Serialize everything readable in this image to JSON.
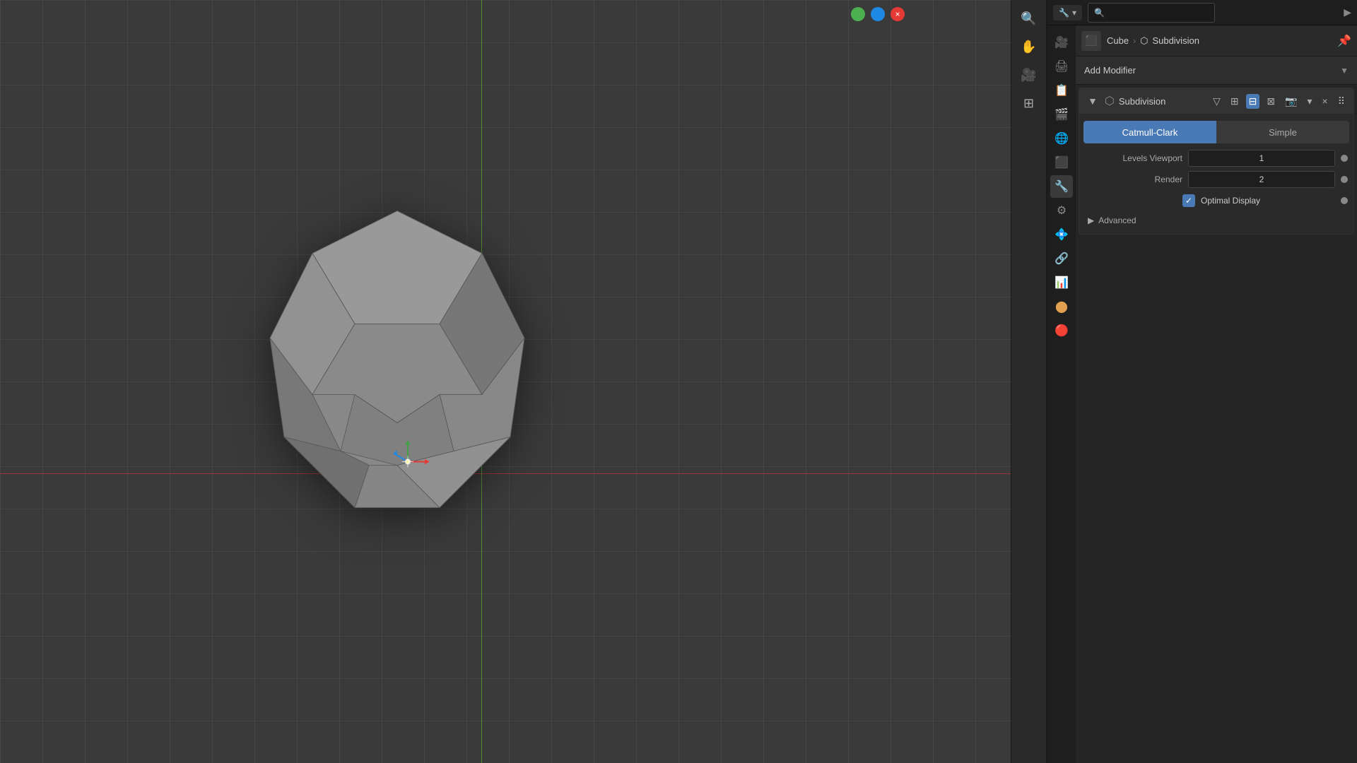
{
  "viewport": {
    "background_color": "#3a3a3a"
  },
  "window_controls": {
    "close_label": "×"
  },
  "toolbar_buttons": [
    {
      "name": "zoom",
      "icon": "🔍"
    },
    {
      "name": "pan",
      "icon": "✋"
    },
    {
      "name": "camera",
      "icon": "🎥"
    },
    {
      "name": "grid",
      "icon": "⊞"
    }
  ],
  "header": {
    "search_placeholder": "🔍",
    "breadcrumb_object": "Cube",
    "breadcrumb_sep": "›",
    "breadcrumb_modifier_icon": "⬡",
    "breadcrumb_modifier": "Subdivision",
    "pin_icon": "📌"
  },
  "add_modifier": {
    "label": "Add Modifier",
    "arrow": "▼"
  },
  "modifier": {
    "name": "Subdivision",
    "collapse_icon": "▼",
    "object_icon": "⬡",
    "icons": [
      "▽",
      "⊞",
      "⊟",
      "⊠",
      "📷"
    ],
    "expand_icon": "▾",
    "delete_icon": "×",
    "grid_icon": "⠿"
  },
  "type_selector": {
    "catmull_clark": "Catmull-Clark",
    "simple": "Simple"
  },
  "params": {
    "levels_viewport_label": "Levels Viewport",
    "levels_viewport_value": "1",
    "render_label": "Render",
    "render_value": "2",
    "optimal_display_label": "Optimal Display",
    "optimal_display_checked": true,
    "advanced_label": "Advanced"
  },
  "sidebar": {
    "icons": [
      {
        "name": "render",
        "icon": "🎥",
        "active": false
      },
      {
        "name": "output",
        "icon": "🖨",
        "active": false
      },
      {
        "name": "view-layer",
        "icon": "📋",
        "active": false
      },
      {
        "name": "scene",
        "icon": "🎬",
        "active": false
      },
      {
        "name": "world",
        "icon": "🌐",
        "active": false
      },
      {
        "name": "object",
        "icon": "⬛",
        "active": false
      },
      {
        "name": "modifiers",
        "icon": "🔧",
        "active": true
      },
      {
        "name": "particles",
        "icon": "⚙",
        "active": false
      },
      {
        "name": "physics",
        "icon": "💠",
        "active": false
      },
      {
        "name": "constraints",
        "icon": "🔗",
        "active": false
      },
      {
        "name": "data",
        "icon": "📊",
        "active": false
      },
      {
        "name": "material",
        "icon": "🟠",
        "active": false
      },
      {
        "name": "shaderfx",
        "icon": "🔴",
        "active": false
      }
    ]
  }
}
